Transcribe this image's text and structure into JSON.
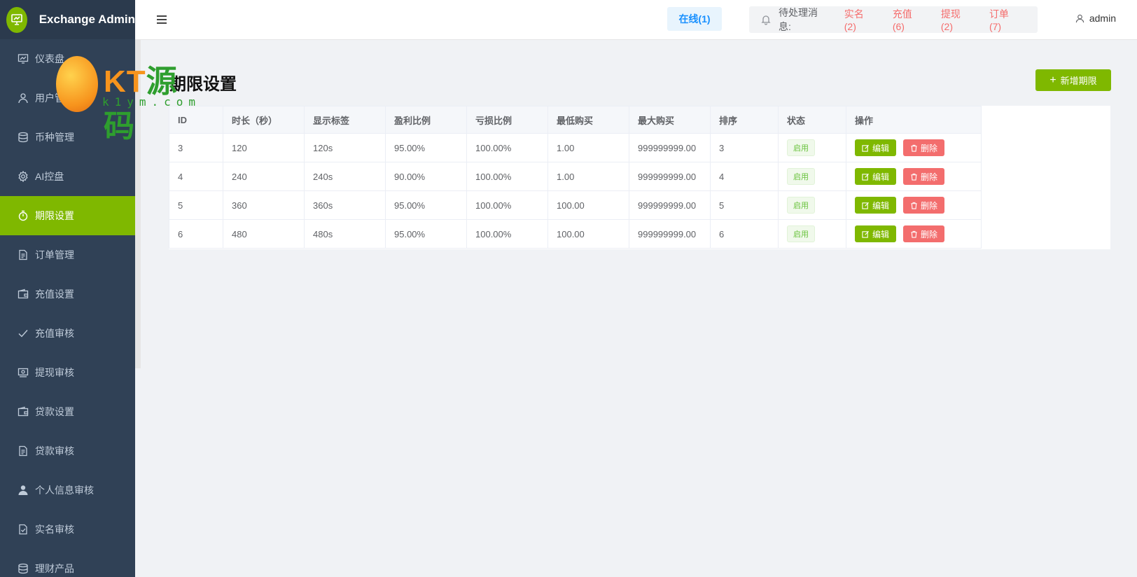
{
  "brand": {
    "title": "Exchange Admin"
  },
  "sidebar": {
    "items": [
      {
        "label": "仪表盘",
        "icon": "chart-icon"
      },
      {
        "label": "用户管理",
        "icon": "user-icon"
      },
      {
        "label": "币种管理",
        "icon": "database-icon"
      },
      {
        "label": "AI控盘",
        "icon": "gear-icon"
      },
      {
        "label": "期限设置",
        "icon": "timer-icon",
        "active": true
      },
      {
        "label": "订单管理",
        "icon": "document-icon"
      },
      {
        "label": "充值设置",
        "icon": "wallet-icon"
      },
      {
        "label": "充值审核",
        "icon": "check-icon"
      },
      {
        "label": "提现审核",
        "icon": "cash-icon"
      },
      {
        "label": "贷款设置",
        "icon": "wallet-icon"
      },
      {
        "label": "贷款审核",
        "icon": "document-icon"
      },
      {
        "label": "个人信息审核",
        "icon": "person-icon"
      },
      {
        "label": "实名审核",
        "icon": "document-check-icon"
      },
      {
        "label": "理财产品",
        "icon": "database-icon"
      }
    ]
  },
  "header": {
    "online": "在线(1)",
    "pending_label": "待处理消息:",
    "pending_tags": [
      "实名(2)",
      "充值(6)",
      "提现(2)",
      "订单(7)"
    ],
    "user": "admin"
  },
  "page": {
    "title": "期限设置",
    "add_button": "新增期限"
  },
  "table": {
    "columns": [
      "ID",
      "时长（秒）",
      "显示标签",
      "盈利比例",
      "亏损比例",
      "最低购买",
      "最大购买",
      "排序",
      "状态",
      "操作"
    ],
    "rows": [
      [
        "3",
        "120",
        "120s",
        "95.00%",
        "100.00%",
        "1.00",
        "999999999.00",
        "3",
        "启用"
      ],
      [
        "4",
        "240",
        "240s",
        "90.00%",
        "100.00%",
        "1.00",
        "999999999.00",
        "4",
        "启用"
      ],
      [
        "5",
        "360",
        "360s",
        "95.00%",
        "100.00%",
        "100.00",
        "999999999.00",
        "5",
        "启用"
      ],
      [
        "6",
        "480",
        "480s",
        "95.00%",
        "100.00%",
        "100.00",
        "999999999.00",
        "6",
        "启用"
      ]
    ],
    "edit_label": "编辑",
    "delete_label": "删除"
  },
  "watermark": {
    "brand_left": "KT",
    "brand_right": "源码",
    "domain": "k1ym.com"
  },
  "colors": {
    "accent": "#7fb800",
    "sidebar_bg": "#304156",
    "danger": "#f36d6d",
    "link": "#1890ff"
  }
}
